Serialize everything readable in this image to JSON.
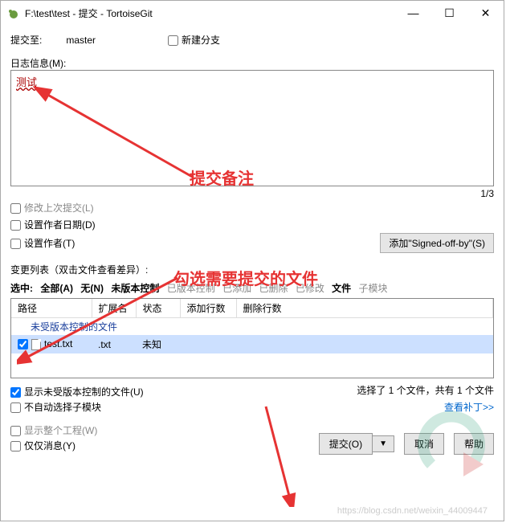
{
  "titlebar": {
    "icon_alt": "tortoise-icon",
    "text": "F:\\test\\test - 提交 - TortoiseGit"
  },
  "commit_to": {
    "label": "提交至:",
    "branch": "master",
    "new_branch_label": "新建分支"
  },
  "log": {
    "label": "日志信息(M):",
    "message": "测试",
    "counter": "1/3"
  },
  "checks": {
    "amend": "修改上次提交(L)",
    "author_date": "设置作者日期(D)",
    "author": "设置作者(T)"
  },
  "signed_off_btn": "添加\"Signed-off-by\"(S)",
  "changes": {
    "header": "变更列表（双击文件查看差异）:",
    "selected_label": "选中:",
    "filters": {
      "all": "全部(A)",
      "none": "无(N)",
      "unversioned": "未版本控制",
      "versioned": "已版本控制",
      "added": "已添加",
      "deleted": "已删除",
      "modified": "已修改",
      "files": "文件",
      "submodule": "子模块"
    },
    "columns": {
      "path": "路径",
      "ext": "扩展名",
      "status": "状态",
      "add_lines": "添加行数",
      "del_lines": "删除行数"
    },
    "group_label": "未受版本控制的文件",
    "rows": [
      {
        "checked": true,
        "name": "test.txt",
        "ext": ".txt",
        "status": "未知"
      }
    ]
  },
  "bottom_checks": {
    "show_unversioned": "显示未受版本控制的文件(U)",
    "no_auto_sub": "不自动选择子模块",
    "show_whole": "显示整个工程(W)",
    "msg_only": "仅仅消息(Y)"
  },
  "status_text": "选择了 1 个文件，共有 1 个文件",
  "view_patch": "查看补丁>>",
  "buttons": {
    "commit": "提交(O)",
    "dropdown": "▼",
    "cancel": "取消",
    "help": "帮助"
  },
  "annotations": {
    "note1": "提交备注",
    "note2": "勾选需要提交的文件"
  },
  "watermark_url": "https://blog.csdn.net/weixin_44009447"
}
